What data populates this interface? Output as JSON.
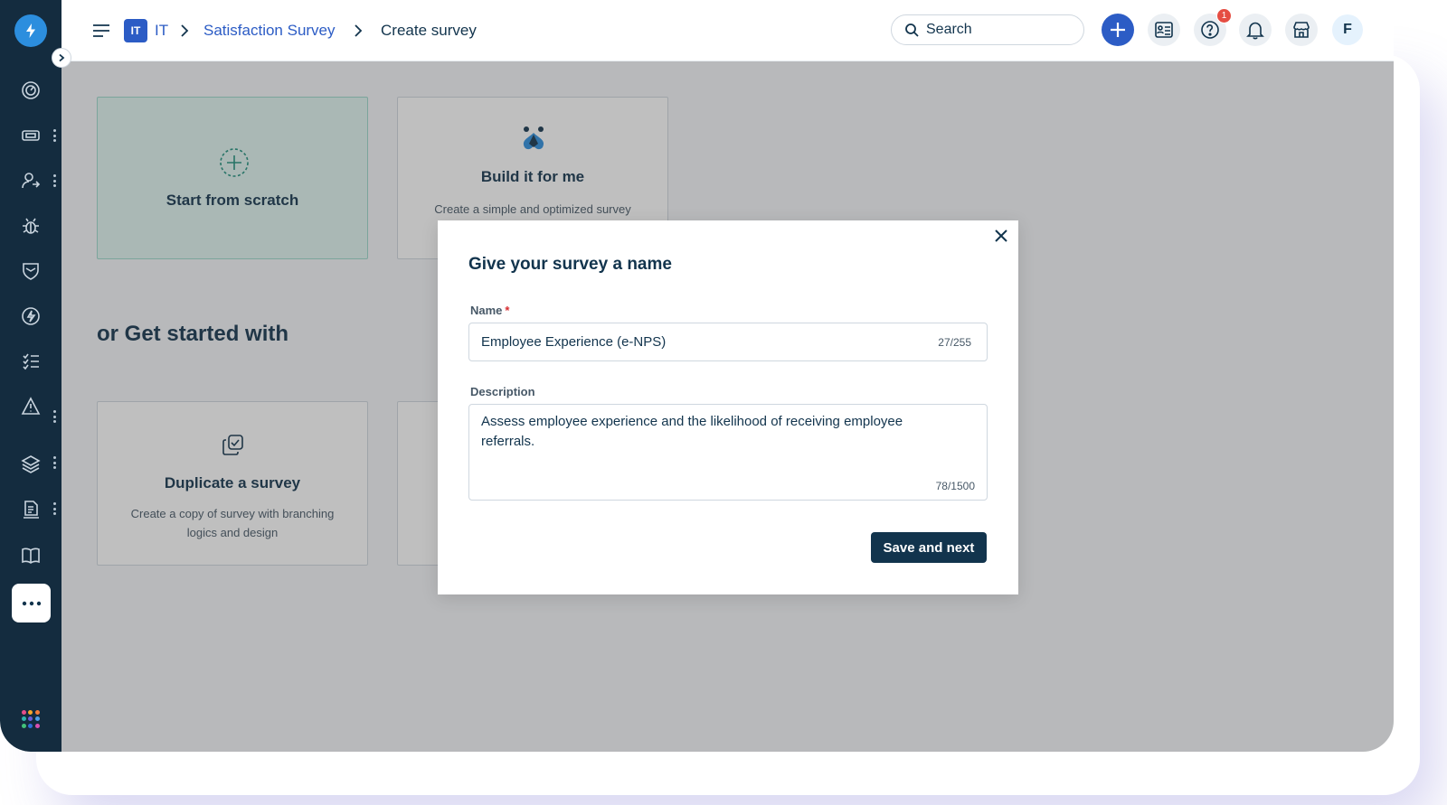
{
  "header": {
    "workspace_badge": "IT",
    "workspace_name": "IT",
    "breadcrumb_survey": "Satisfaction Survey",
    "breadcrumb_current": "Create survey",
    "search_placeholder": "Search",
    "notification_count": "1",
    "avatar_initial": "F"
  },
  "sidebar": {
    "items": [
      "dashboard-icon",
      "tickets-icon",
      "contacts-icon",
      "problems-icon",
      "changes-icon",
      "releases-icon",
      "tasks-icon",
      "alerts-icon",
      "assets-icon",
      "reports-icon",
      "knowledge-icon"
    ]
  },
  "cards": {
    "scratch_title": "Start from scratch",
    "build_title": "Build it for me",
    "build_desc": "Create a simple and optimized survey",
    "section_heading": "or Get started with",
    "duplicate_title": "Duplicate a survey",
    "duplicate_desc_line1": "Create a copy of survey with branching",
    "duplicate_desc_line2": "logics and design"
  },
  "modal": {
    "title": "Give your survey a name",
    "name_label": "Name",
    "name_required": "*",
    "name_value": "Employee Experience (e-NPS)",
    "name_counter": "27/255",
    "description_label": "Description",
    "description_value": "Assess employee experience and the likelihood of receiving employee referrals.",
    "description_counter": "78/1500",
    "save_label": "Save and next"
  },
  "colors": {
    "sidebar_bg": "#142c3f",
    "accent_blue": "#2c5cc5",
    "primary_button": "#12344d",
    "selected_card": "#e0f5f1",
    "badge_red": "#e54d42"
  }
}
